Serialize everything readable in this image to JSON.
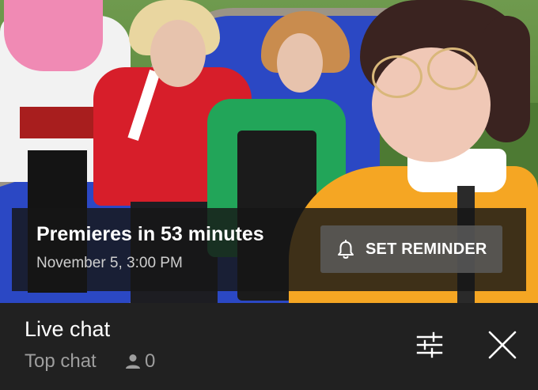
{
  "premiere": {
    "title": "Premieres in 53 minutes",
    "date": "November 5, 3:00 PM",
    "reminder_label": "SET REMINDER",
    "bell_icon": "bell-icon"
  },
  "live_chat": {
    "title": "Live chat",
    "mode": "Top chat",
    "viewer_count": "0",
    "viewer_icon": "person-icon",
    "filter_icon": "sliders-icon",
    "close_icon": "close-icon"
  },
  "colors": {
    "overlay": "#161616",
    "chat_bar": "#212121",
    "muted_text": "#9e9e9e"
  }
}
